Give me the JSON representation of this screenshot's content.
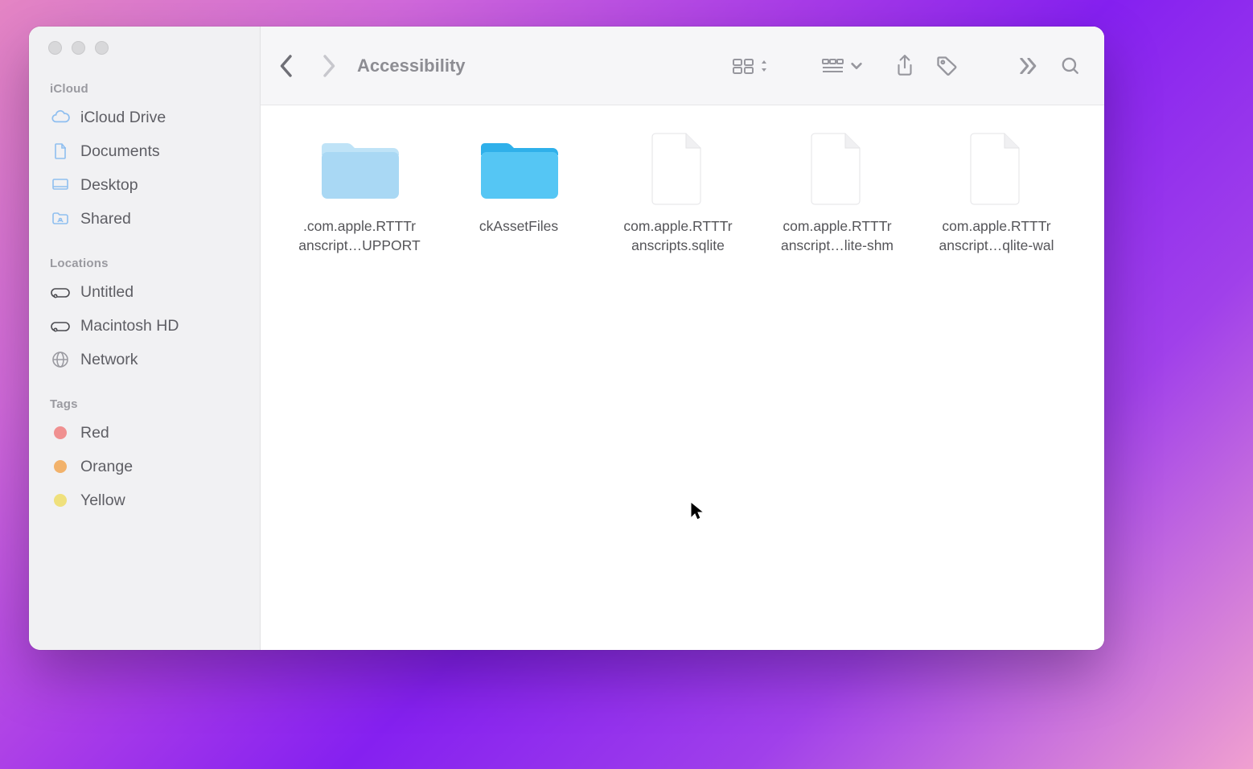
{
  "window": {
    "title": "Accessibility"
  },
  "sidebar": {
    "sections": {
      "icloud": {
        "label": "iCloud",
        "items": [
          {
            "label": "iCloud Drive"
          },
          {
            "label": "Documents"
          },
          {
            "label": "Desktop"
          },
          {
            "label": "Shared"
          }
        ]
      },
      "locations": {
        "label": "Locations",
        "items": [
          {
            "label": "Untitled"
          },
          {
            "label": "Macintosh HD"
          },
          {
            "label": "Network"
          }
        ]
      },
      "tags": {
        "label": "Tags",
        "items": [
          {
            "label": "Red",
            "color": "#f09090"
          },
          {
            "label": "Orange",
            "color": "#f2b26b"
          },
          {
            "label": "Yellow",
            "color": "#efe07c"
          }
        ]
      }
    }
  },
  "content": {
    "items": [
      {
        "type": "folder",
        "selected": false,
        "color": "light",
        "line1": ".com.apple.RTTTr",
        "line2": "anscript…UPPORT"
      },
      {
        "type": "folder",
        "selected": true,
        "color": "blue",
        "line1": "ckAssetFiles",
        "line2": ""
      },
      {
        "type": "file",
        "selected": false,
        "line1": "com.apple.RTTTr",
        "line2": "anscripts.sqlite"
      },
      {
        "type": "file",
        "selected": false,
        "line1": "com.apple.RTTTr",
        "line2": "anscript…lite-shm"
      },
      {
        "type": "file",
        "selected": false,
        "line1": "com.apple.RTTTr",
        "line2": "anscript…qlite-wal"
      }
    ]
  },
  "colors": {
    "folder_light_top": "#bfe3f7",
    "folder_light_body": "#a9d8f4",
    "folder_blue_top": "#3fb9ef",
    "folder_blue_body": "#55c6f4"
  }
}
